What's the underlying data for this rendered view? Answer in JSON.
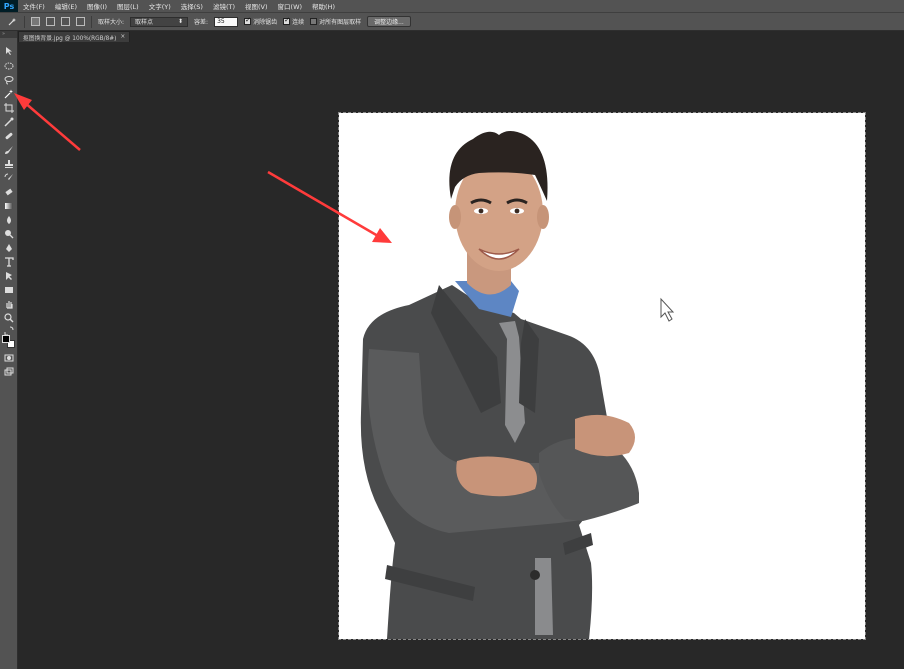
{
  "app": {
    "logo": "Ps"
  },
  "menu": [
    "文件(F)",
    "编辑(E)",
    "图像(I)",
    "图层(L)",
    "文字(Y)",
    "选择(S)",
    "滤镜(T)",
    "视图(V)",
    "窗口(W)",
    "帮助(H)"
  ],
  "options": {
    "sample_size_label": "取样大小:",
    "sample_size_value": "取样点",
    "tolerance_label": "容差:",
    "tolerance_value": "35",
    "antialias_label": "消除锯齿",
    "contiguous_label": "连续",
    "all_layers_label": "对所有图层取样",
    "refine_edge_label": "调整边缘..."
  },
  "document": {
    "tab_title": "抠图换背景.jpg @ 100%(RGB/8#)",
    "close_glyph": "×"
  },
  "colors": {
    "arrow": "#ff3b3b",
    "canvas_bg": "#ffffff",
    "workspace": "#282828",
    "panel": "#535353"
  },
  "tools": [
    "move-icon",
    "marquee-icon",
    "lasso-icon",
    "magic-wand-icon",
    "crop-icon",
    "eyedropper-icon",
    "healing-icon",
    "brush-icon",
    "stamp-icon",
    "history-brush-icon",
    "eraser-icon",
    "gradient-icon",
    "blur-icon",
    "dodge-icon",
    "pen-icon",
    "type-icon",
    "path-select-icon",
    "rectangle-icon",
    "hand-icon",
    "zoom-icon"
  ]
}
